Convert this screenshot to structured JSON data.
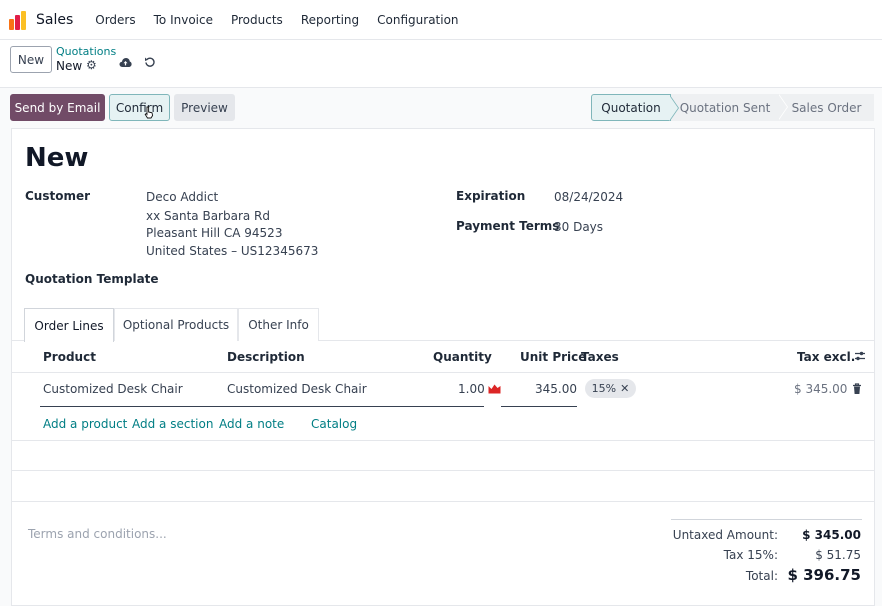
{
  "app": {
    "name": "Sales"
  },
  "nav": {
    "items": [
      "Orders",
      "To Invoice",
      "Products",
      "Reporting",
      "Configuration"
    ]
  },
  "control": {
    "new_label": "New",
    "breadcrumb": "Quotations",
    "current": "New",
    "icons": [
      "gear-icon",
      "cloud-upload-icon",
      "undo-icon"
    ]
  },
  "actions": {
    "send_email": "Send by Email",
    "confirm": "Confirm",
    "preview": "Preview"
  },
  "status": {
    "stages": [
      "Quotation",
      "Quotation Sent",
      "Sales Order"
    ],
    "active": "Quotation"
  },
  "form": {
    "title": "New",
    "customer_label": "Customer",
    "customer_name": "Deco Addict",
    "address_1": "xx Santa Barbara Rd",
    "address_2": "Pleasant Hill CA 94523",
    "address_3": "United States – US12345673",
    "expiration_label": "Expiration",
    "expiration_value": "08/24/2024",
    "payment_terms_label": "Payment Terms",
    "payment_terms_value": "30 Days",
    "quotation_template_label": "Quotation Template"
  },
  "tabs": [
    "Order Lines",
    "Optional Products",
    "Other Info"
  ],
  "order_lines": {
    "columns": [
      "Product",
      "Description",
      "Quantity",
      "Unit Price",
      "Taxes",
      "Tax excl."
    ],
    "rows": [
      {
        "product": "Customized Desk Chair",
        "description": "Customized Desk Chair",
        "quantity": "1.00",
        "unit_price": "345.00",
        "taxes": "15%",
        "tax_excl": "$ 345.00"
      }
    ],
    "links": [
      "Add a product",
      "Add a section",
      "Add a note",
      "Catalog"
    ]
  },
  "footer": {
    "terms_placeholder": "Terms and conditions...",
    "untaxed_label": "Untaxed Amount:",
    "untaxed_value": "$ 345.00",
    "tax_label": "Tax 15%:",
    "tax_value": "$ 51.75",
    "total_label": "Total:",
    "total_value": "$ 396.75"
  },
  "colors": {
    "brand": "#714b67",
    "accent": "#017e84"
  }
}
